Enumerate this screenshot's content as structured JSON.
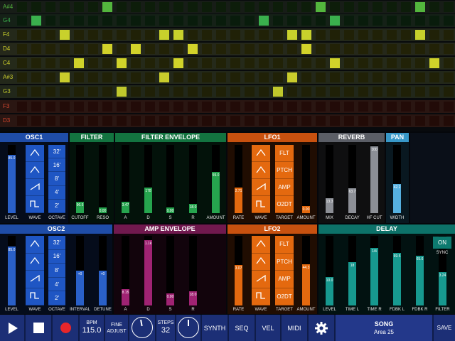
{
  "note_rows": [
    {
      "label": "A#4",
      "color": "#53b53d",
      "bg": "#171d17",
      "cells": [
        0,
        0,
        0,
        0,
        0,
        0,
        2,
        0,
        0,
        0,
        0,
        0,
        0,
        0,
        0,
        0,
        0,
        0,
        0,
        0,
        0,
        2,
        0,
        0,
        0,
        0,
        0,
        0,
        2,
        0,
        0,
        0
      ]
    },
    {
      "label": "G4",
      "color": "#3ab04d",
      "bg": "#152117",
      "cells": [
        0,
        2,
        0,
        0,
        0,
        0,
        0,
        0,
        0,
        0,
        0,
        0,
        0,
        0,
        0,
        0,
        0,
        2,
        0,
        0,
        0,
        0,
        2,
        0,
        0,
        0,
        0,
        0,
        0,
        0,
        0,
        0
      ]
    },
    {
      "label": "F4",
      "color": "#c8d12c",
      "bg": "#24291a",
      "cells": [
        0,
        0,
        0,
        1,
        0,
        0,
        0,
        0,
        0,
        0,
        1,
        1,
        0,
        0,
        0,
        0,
        0,
        0,
        0,
        1,
        1,
        0,
        0,
        0,
        0,
        0,
        0,
        0,
        1,
        0,
        0,
        0
      ]
    },
    {
      "label": "D4",
      "color": "#d2d22a",
      "bg": "#25281a",
      "cells": [
        0,
        0,
        0,
        0,
        0,
        0,
        1,
        0,
        1,
        0,
        0,
        0,
        1,
        0,
        0,
        0,
        0,
        0,
        0,
        0,
        1,
        0,
        0,
        0,
        0,
        0,
        0,
        0,
        0,
        0,
        0,
        0
      ]
    },
    {
      "label": "C4",
      "color": "#d0d32a",
      "bg": "#252a1a",
      "cells": [
        0,
        0,
        0,
        0,
        1,
        0,
        0,
        1,
        0,
        0,
        0,
        1,
        0,
        0,
        0,
        0,
        0,
        0,
        0,
        0,
        0,
        0,
        1,
        0,
        0,
        0,
        0,
        0,
        0,
        1,
        0,
        0
      ]
    },
    {
      "label": "A#3",
      "color": "#c9cc2c",
      "bg": "#23281a",
      "cells": [
        0,
        0,
        0,
        1,
        0,
        0,
        0,
        0,
        0,
        0,
        1,
        0,
        0,
        0,
        0,
        0,
        0,
        0,
        0,
        1,
        0,
        0,
        0,
        0,
        0,
        0,
        0,
        0,
        0,
        0,
        0,
        0
      ]
    },
    {
      "label": "G3",
      "color": "#c0c82c",
      "bg": "#21271a",
      "cells": [
        0,
        0,
        0,
        0,
        0,
        0,
        0,
        1,
        0,
        0,
        0,
        0,
        0,
        0,
        0,
        0,
        0,
        0,
        1,
        0,
        0,
        0,
        0,
        0,
        0,
        0,
        0,
        0,
        0,
        0,
        0,
        0
      ]
    },
    {
      "label": "F3",
      "color": "#d5472f",
      "bg": "#2a1612",
      "cells": [
        0,
        0,
        0,
        0,
        0,
        0,
        0,
        0,
        0,
        0,
        0,
        0,
        0,
        0,
        0,
        0,
        0,
        0,
        0,
        0,
        0,
        0,
        0,
        0,
        0,
        0,
        0,
        0,
        0,
        0,
        0,
        0
      ]
    },
    {
      "label": "D3",
      "color": "#d4442d",
      "bg": "#2a1612",
      "cells": [
        0,
        0,
        0,
        0,
        0,
        0,
        0,
        0,
        0,
        0,
        0,
        0,
        0,
        0,
        0,
        0,
        0,
        0,
        0,
        0,
        0,
        0,
        0,
        0,
        0,
        0,
        0,
        0,
        0,
        0,
        0,
        0
      ]
    }
  ],
  "sections_top": [
    {
      "title": "OSC1",
      "color": "#1f4da8"
    },
    {
      "title": "FILTER",
      "color": "#137340"
    },
    {
      "title": "FILTER ENVELOPE",
      "color": "#137340"
    },
    {
      "title": "LFO1",
      "color": "#c8510f"
    },
    {
      "title": "REVERB",
      "color": "#5b5e66"
    },
    {
      "title": "PAN",
      "color": "#3898c8"
    }
  ],
  "sections_bottom": [
    {
      "title": "OSC2",
      "color": "#1f4da8"
    },
    {
      "title": "AMP ENVELOPE",
      "color": "#70194e"
    },
    {
      "title": "LFO2",
      "color": "#c8510f"
    },
    {
      "title": "DELAY",
      "color": "#0d7269"
    }
  ],
  "sliders_top": [
    {
      "label": "LEVEL",
      "value_text": "85.0",
      "value": 0.85,
      "color": "#2a60c8"
    },
    {
      "label": "CUTOFF",
      "value_text": "96.5",
      "value": 0.17,
      "color": "#26a44e"
    },
    {
      "label": "RESO",
      "value_text": "0.00",
      "value": 0.08,
      "color": "#26a44e"
    },
    {
      "label": "A",
      "value_text": "3.47",
      "value": 0.17,
      "color": "#26a44e"
    },
    {
      "label": "D",
      "value_text": "178",
      "value": 0.38,
      "color": "#26a44e"
    },
    {
      "label": "S",
      "value_text": "0.00",
      "value": 0.08,
      "color": "#26a44e"
    },
    {
      "label": "R",
      "value_text": "18.0",
      "value": 0.14,
      "color": "#26a44e"
    },
    {
      "label": "AMOUNT",
      "value_text": "59.0",
      "value": 0.6,
      "color": "#26a44e"
    },
    {
      "label": "RATE",
      "value_text": "2.71",
      "value": 0.37,
      "color": "#e4690f"
    },
    {
      "label": "AMOUNT",
      "value_text": "0.00",
      "value": 0.1,
      "color": "#e4690f"
    },
    {
      "label": "MIX",
      "value_text": "13.3",
      "value": 0.22,
      "color": "#8c8f96"
    },
    {
      "label": "DECAY",
      "value_text": "63.7",
      "value": 0.36,
      "color": "#8c8f96"
    },
    {
      "label": "HF CUT",
      "value_text": "100",
      "value": 0.98,
      "color": "#8c8f96"
    },
    {
      "label": "WIDTH",
      "value_text": "42.2",
      "value": 0.43,
      "color": "#55b0e0"
    }
  ],
  "sliders_bottom": [
    {
      "label": "LEVEL",
      "value_text": "85.0",
      "value": 0.85,
      "color": "#2a60c8"
    },
    {
      "label": "INTERVAL",
      "value_text": "+0",
      "value": 0.5,
      "color": "#2a60c8"
    },
    {
      "label": "DETUNE",
      "value_text": "+0",
      "value": 0.5,
      "color": "#2a60c8"
    },
    {
      "label": "A",
      "value_text": "8.15",
      "value": 0.23,
      "color": "#a02373"
    },
    {
      "label": "D",
      "value_text": "1.1k",
      "value": 0.94,
      "color": "#a02373"
    },
    {
      "label": "S",
      "value_text": "0.00",
      "value": 0.17,
      "color": "#a02373"
    },
    {
      "label": "R",
      "value_text": "18.0",
      "value": 0.2,
      "color": "#a02373"
    },
    {
      "label": "RATE",
      "value_text": "3.07",
      "value": 0.58,
      "color": "#e4690f"
    },
    {
      "label": "AMOUNT",
      "value_text": "44.3",
      "value": 0.59,
      "color": "#e4690f"
    },
    {
      "label": "LEVEL",
      "value_text": "10.0",
      "value": 0.41,
      "color": "#17998f"
    },
    {
      "label": "TIME L",
      "value_text": "18",
      "value": 0.62,
      "color": "#17998f"
    },
    {
      "label": "TIME R",
      "value_text": "1/4",
      "value": 0.83,
      "color": "#17998f"
    },
    {
      "label": "FDBK L",
      "value_text": "69.5",
      "value": 0.76,
      "color": "#17998f"
    },
    {
      "label": "FDBK R",
      "value_text": "65.6",
      "value": 0.71,
      "color": "#17998f"
    },
    {
      "label": "FILTER",
      "value_text": "3.24",
      "value": 0.48,
      "color": "#17998f"
    }
  ],
  "osc1": {
    "wave_label": "WAVE",
    "octave_label": "OCTAVE",
    "octaves": [
      "32'",
      "16'",
      "8'",
      "4'",
      "2'"
    ],
    "selected_wave": 0,
    "selected_octave": 0
  },
  "osc2": {
    "wave_label": "WAVE",
    "octave_label": "OCTAVE",
    "octaves": [
      "32'",
      "16'",
      "8'",
      "4'",
      "2'"
    ],
    "selected_wave": 2,
    "selected_octave": 0
  },
  "lfo1": {
    "wave_label": "WAVE",
    "target_label": "TARGET",
    "targets": [
      "FLT",
      "PTCH",
      "AMP",
      "O2DT"
    ]
  },
  "lfo2": {
    "wave_label": "WAVE",
    "target_label": "TARGET",
    "targets": [
      "FLT",
      "PTCH",
      "AMP",
      "O2DT"
    ]
  },
  "delay": {
    "sync_on_label": "ON",
    "sync_label": "SYNC"
  },
  "transport": {
    "bpm_label": "BPM",
    "bpm_value": "115.0",
    "fine_label": "FINE",
    "adjust_label": "ADJUST",
    "steps_label": "STEPS",
    "steps_value": "32",
    "synth_label": "SYNTH",
    "seq_label": "SEQ",
    "vel_label": "VEL",
    "midi_label": "MIDI",
    "song_label": "SONG",
    "song_name": "Area 25",
    "save_label": "SAVE"
  },
  "colors": {
    "accent_blue": "#1c2f76",
    "record_red": "#e8262a",
    "panel_bg": "#0b1220"
  }
}
